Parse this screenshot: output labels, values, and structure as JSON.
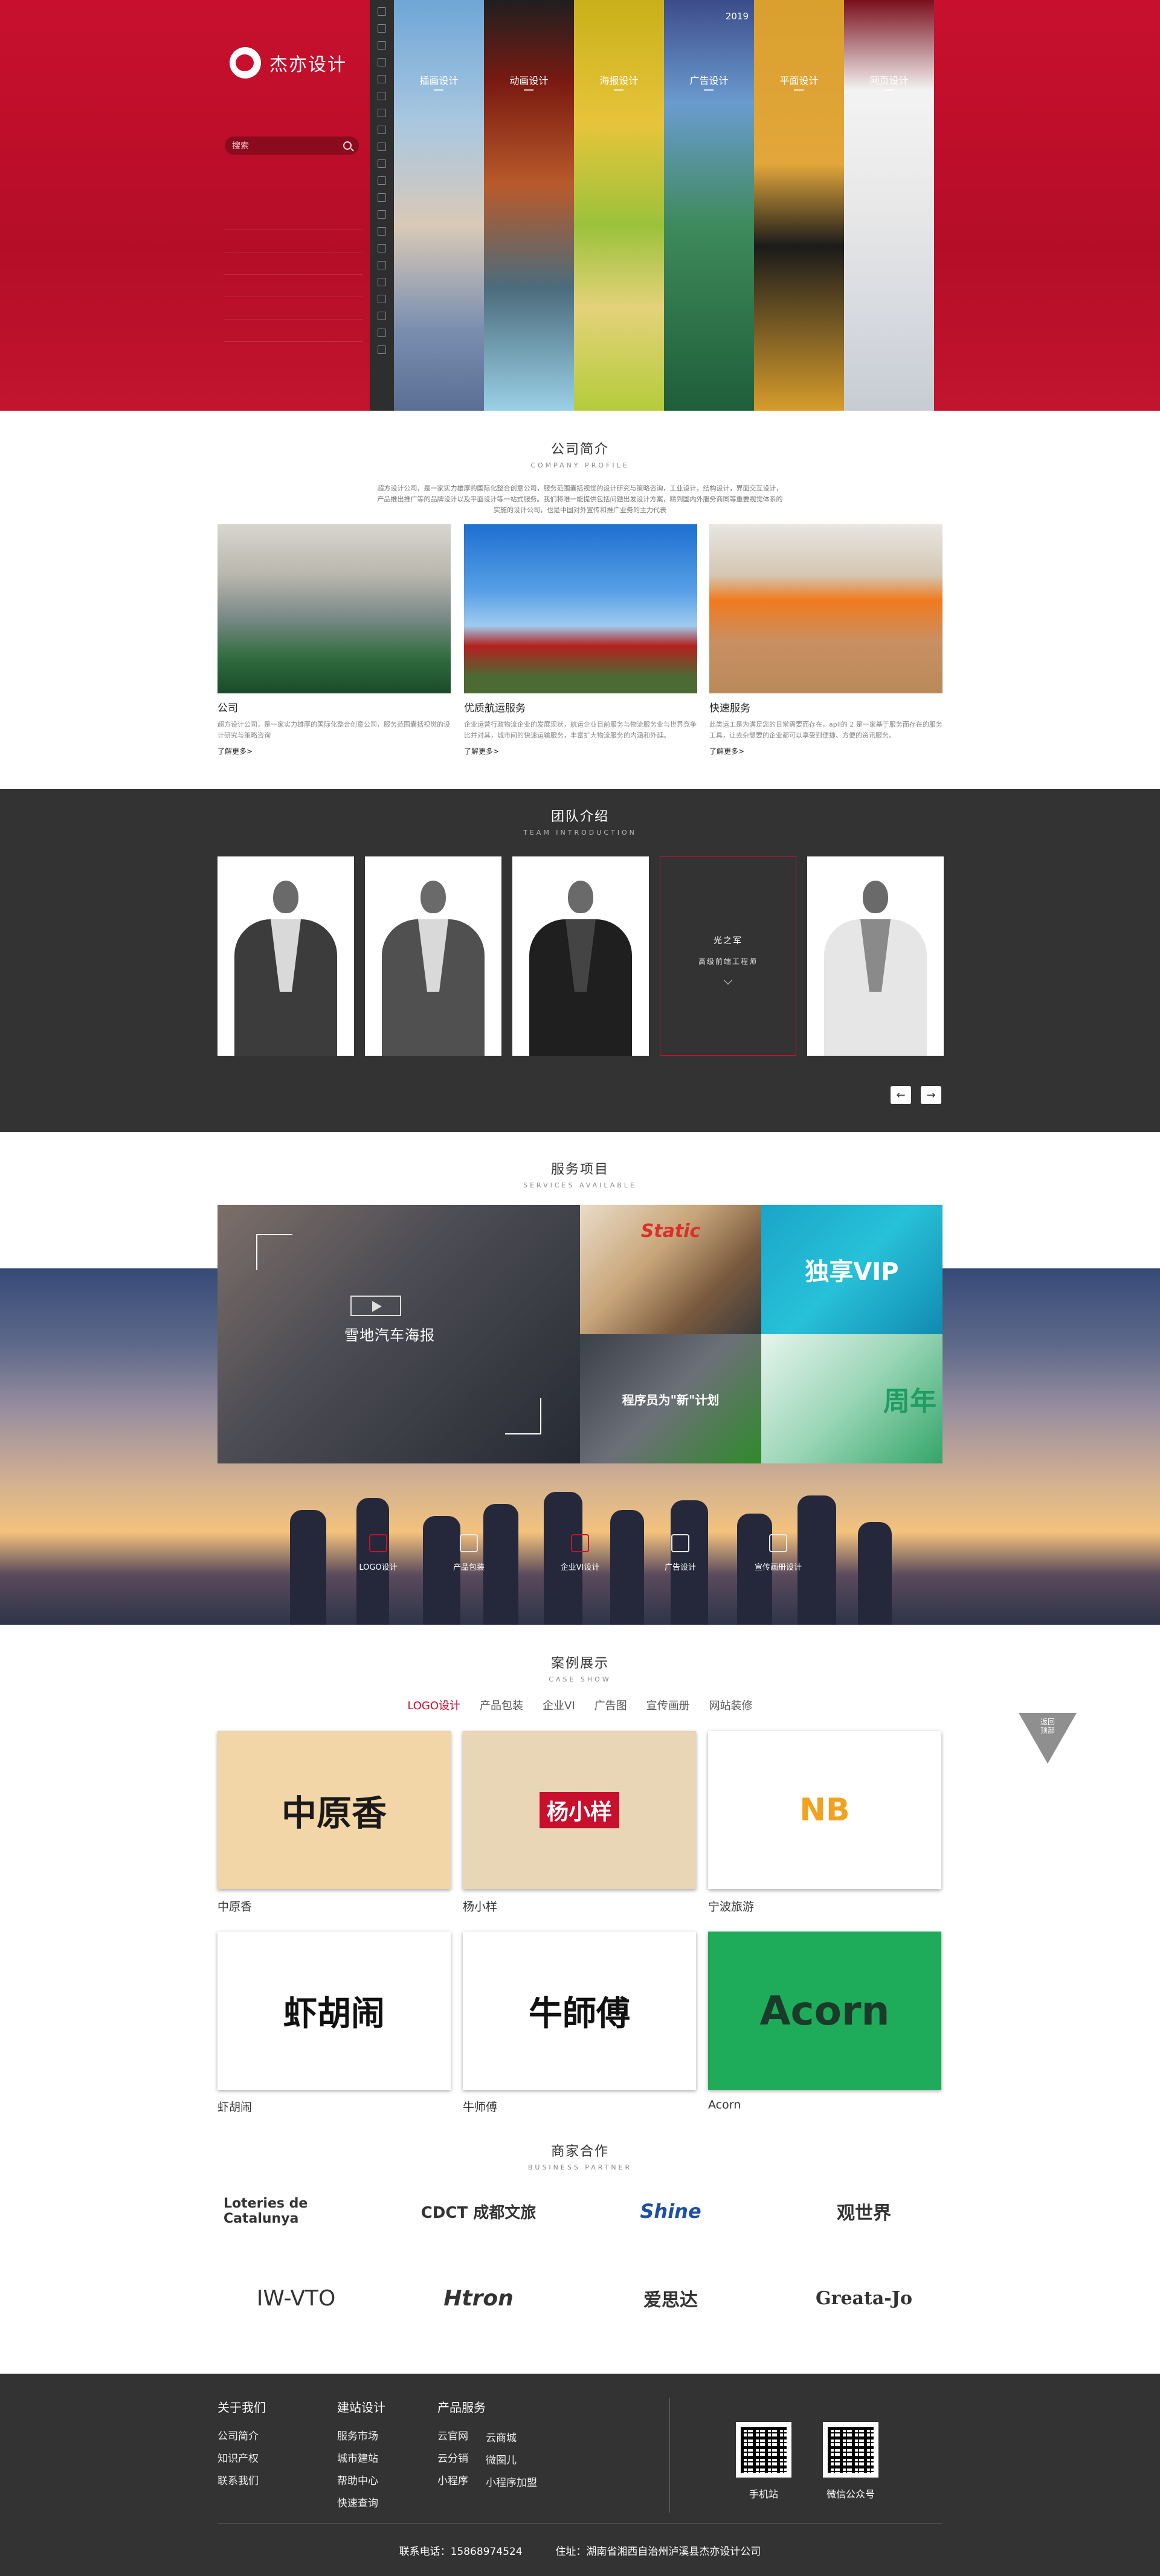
{
  "hero": {
    "logo_text": "杰亦设计",
    "search_placeholder": "搜索",
    "panels": [
      "插画设计",
      "动画设计",
      "海报设计",
      "广告设计",
      "平面设计",
      "网页设计"
    ],
    "panel_years": "2019"
  },
  "company": {
    "title": "公司简介",
    "subtitle": "COMPANY PROFILE",
    "intro": "超方设计公司，是一家实力雄厚的国际化整合创意公司，服务范围囊括视觉的设计研究与策略咨询，工业设计，结构设计，界面交互设计，产品推出推广等的品牌设计以及平面设计等一站式服务。我们将唯一能提供包括问题出发设计方案，精到国内外服务商同等重要视觉体系的实施的设计公司，也是中国对外宣传和推广业务的主力代表",
    "cards": [
      {
        "title": "公司",
        "text": "超方设计公司，是一家实力雄厚的国际化整合创意公司，服务范围囊括视觉的设计研究与策略咨询",
        "more": "了解更多>"
      },
      {
        "title": "优质航运服务",
        "text": "企业运营行政物流企业的发展现状，航运企业目前服务与物流服务业与世界竞争比并对其，城市间的快速运输服务，丰富扩大物流服务的内涵和外延。",
        "more": "了解更多>"
      },
      {
        "title": "快速服务",
        "text": "此类运工是为满足您的日常需要而存在，apll的 2 是一家基于服务而存在的服务工具，让去杂想要的企业都可以享受到便捷、方便的资讯服务。",
        "more": "了解更多>"
      }
    ]
  },
  "team": {
    "title": "团队介绍",
    "subtitle": "TEAM INTRODUCTION",
    "featured_name": "光之军",
    "featured_role": "高级前端工程师",
    "prev_label": "←",
    "next_label": "→"
  },
  "services": {
    "title": "服务项目",
    "subtitle": "SERVICES AVAILABLE",
    "big_caption": "雪地汽车海报",
    "tiles": [
      "Static",
      "独享VIP",
      "程序员为\"新\"计划",
      "周年"
    ],
    "categories": [
      "LOGO设计",
      "产品包装",
      "企业VI设计",
      "广告设计",
      "宣传画册设计"
    ]
  },
  "cases": {
    "title": "案例展示",
    "subtitle": "CASE SHOW",
    "tabs": [
      "LOGO设计",
      "产品包装",
      "企业VI",
      "广告图",
      "宣传画册",
      "网站装修"
    ],
    "items": [
      {
        "name": "中原香",
        "logo": "中原香"
      },
      {
        "name": "杨小样",
        "logo": "杨小样"
      },
      {
        "name": "宁波旅游",
        "logo": "NB"
      },
      {
        "name": "虾胡闹",
        "logo": "虾胡闹"
      },
      {
        "name": "牛师傅",
        "logo": "牛師傅"
      },
      {
        "name": "Acorn",
        "logo": "Acorn"
      }
    ],
    "back_top": "返回\n顶部"
  },
  "partners": {
    "title": "商家合作",
    "subtitle": "BUSINESS PARTNER",
    "items": [
      "Loteries de Catalunya",
      "CDCT 成都文旅",
      "Shine",
      "观世界",
      "IW-VTO",
      "Htron",
      "爱思达",
      "Greata-Jo"
    ]
  },
  "footer": {
    "col1": {
      "heading": "关于我们",
      "items": [
        "公司简介",
        "知识产权",
        "联系我们"
      ]
    },
    "col2": {
      "heading": "建站设计",
      "items": [
        "服务市场",
        "城市建站",
        "帮助中心",
        "快速查询"
      ]
    },
    "col3": {
      "heading": "产品服务",
      "items": [
        "云官网",
        "云分销",
        "小程序"
      ]
    },
    "col4": {
      "items": [
        "云商城",
        "微圈儿",
        "小程序加盟"
      ]
    },
    "qr1_label": "手机站",
    "qr2_label": "微信公众号",
    "phone": "联系电话：15868974524",
    "address": "住址：湖南省湘西自治州泸溪县杰亦设计公司"
  }
}
